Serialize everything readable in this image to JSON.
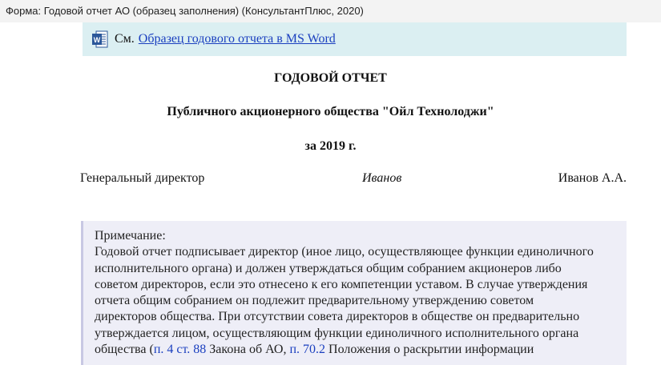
{
  "window": {
    "title": "Форма: Годовой отчет АО (образец заполнения) (КонсультантПлюс, 2020)"
  },
  "word_link": {
    "icon": "word-doc-icon",
    "prefix": "См.",
    "link_text": "Образец годового отчета в MS Word"
  },
  "document": {
    "heading": "ГОДОВОЙ ОТЧЕТ",
    "company": "Публичного акционерного общества \"Ойл Технолоджи\"",
    "year": "за 2019 г.",
    "signature": {
      "position": "Генеральный директор",
      "sign": "Иванов",
      "name": "Иванов А.А."
    }
  },
  "note": {
    "title": "Примечание:",
    "lines": [
      "Годовой отчет подписывает директор (иное лицо, осуществляющее функции единоличного",
      "исполнительного органа) и должен утверждаться общим собранием акционеров либо",
      "советом директоров, если это отнесено к его компетенции уставом. В случае утверждения",
      "отчета общим собранием он подлежит предварительному утверждению советом",
      "директоров общества. При отсутствии совета директоров в обществе он предварительно",
      "утверждается лицом, осуществляющим функции единоличного исполнительного органа"
    ],
    "last_line": {
      "text1": "общества (",
      "link1": "п. 4 ст. 88",
      "text2": " Закона об АО, ",
      "link2": "п. 70.2",
      "text3": " Положения о раскрытии информации"
    }
  },
  "colors": {
    "link": "#1a3fbf",
    "word_banner_bg": "#dbeff2",
    "note_bg": "#eeeef7",
    "word_icon": "#2b579a"
  }
}
